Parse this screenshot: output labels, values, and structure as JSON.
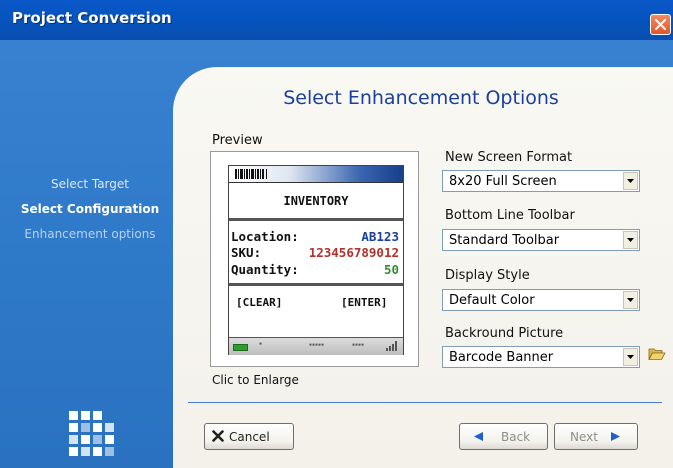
{
  "window": {
    "title": "Project Conversion"
  },
  "sidebar": {
    "steps": [
      {
        "label": "Select Target",
        "state": "done"
      },
      {
        "label": "Select Configuration",
        "state": "current"
      },
      {
        "label": "Enhancement options",
        "state": "pending"
      }
    ]
  },
  "panel": {
    "title": "Select Enhancement Options",
    "preview_label": "Preview",
    "enlarge_label": "Clic to Enlarge"
  },
  "device_preview": {
    "screen_title": "INVENTORY",
    "rows": [
      {
        "key": "Location:",
        "value": "AB123"
      },
      {
        "key": "SKU:",
        "value": "123456789012"
      },
      {
        "key": "Quantity:",
        "value": "50"
      }
    ],
    "left_key": "[CLEAR]",
    "right_key": "[ENTER]"
  },
  "fields": {
    "screen_format": {
      "label": "New Screen Format",
      "value": "8x20 Full Screen"
    },
    "bottom_toolbar": {
      "label": "Bottom Line Toolbar",
      "value": "Standard Toolbar"
    },
    "display_style": {
      "label": "Display Style",
      "value": "Default Color"
    },
    "background_picture": {
      "label": "Backround Picture",
      "value": "Barcode Banner"
    }
  },
  "buttons": {
    "cancel": "Cancel",
    "back": "Back",
    "next": "Next"
  },
  "icons": {
    "close": "close-icon",
    "cancel": "x-icon",
    "back": "arrow-left-icon",
    "next": "arrow-right-icon",
    "folder": "folder-open-icon",
    "logo": "grid-logo-icon"
  },
  "colors": {
    "titlebar": "#0553bd",
    "sidebar_bg": "#2f78c6",
    "panel_bg": "#f6f5ef",
    "title_text": "#1b3f9c",
    "close_button": "#e1562b",
    "sku_value": "#b2312a",
    "quantity_value": "#2e8f2e"
  }
}
